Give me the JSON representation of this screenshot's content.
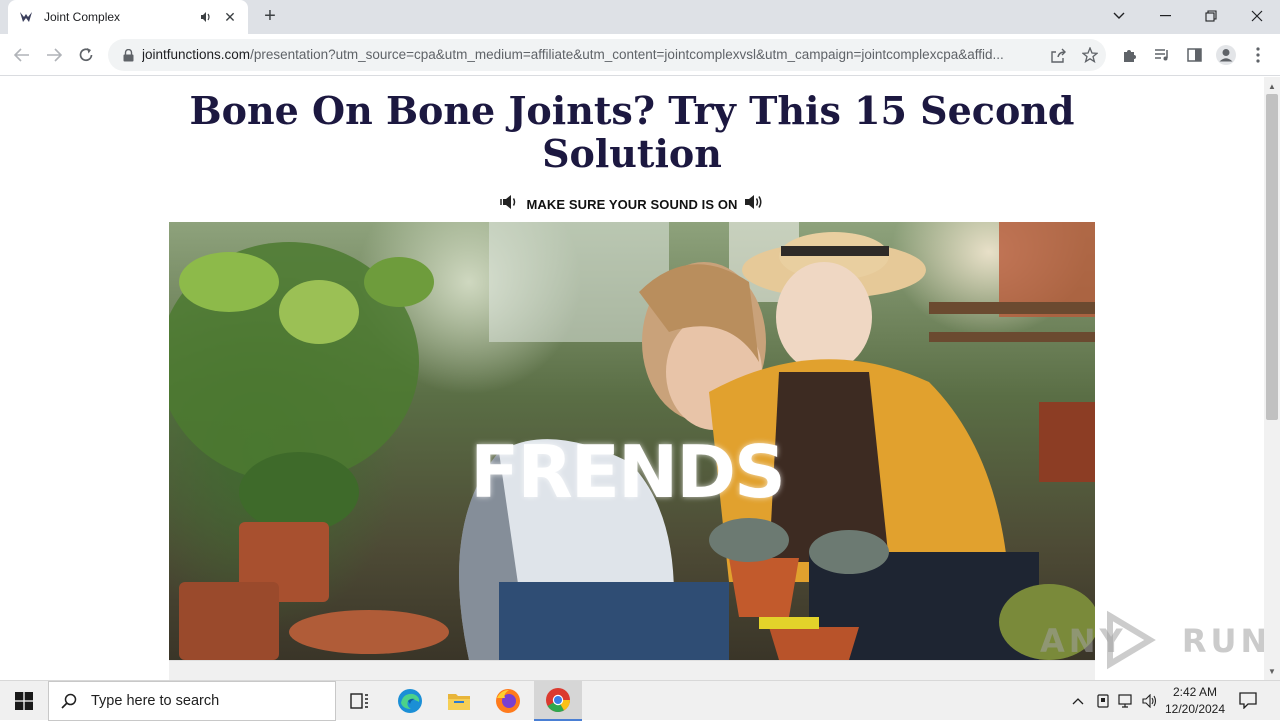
{
  "browser": {
    "tab": {
      "title": "Joint Complex"
    },
    "url": {
      "host": "jointfunctions.com",
      "path": "/presentation?utm_source=cpa&utm_medium=affiliate&utm_content=jointcomplexvsl&utm_campaign=jointcomplexcpa&affid..."
    }
  },
  "page": {
    "headline": "Bone On Bone Joints? Try This 15 Second Solution",
    "sound_notice": "MAKE SURE YOUR SOUND IS ON",
    "video": {
      "overlay_text": "FRENDS",
      "watermark": "ANY RUN"
    }
  },
  "taskbar": {
    "search_placeholder": "Type here to search",
    "time": "2:42 AM",
    "date": "12/20/2024"
  },
  "colors": {
    "headline": "#1c1840",
    "taskbar_active_underline": "#4a7fd4"
  }
}
